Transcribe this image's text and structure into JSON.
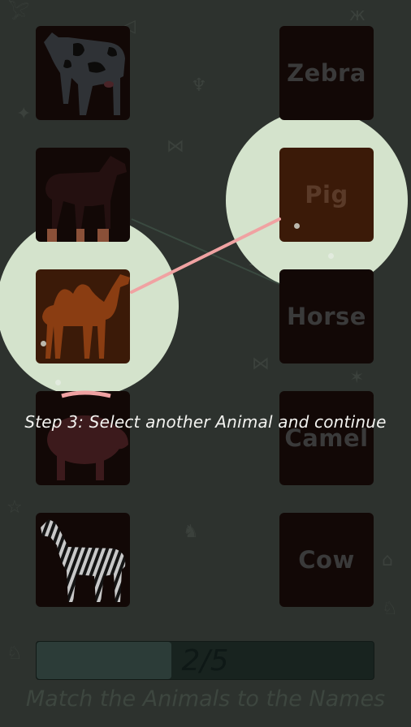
{
  "instruction": "Step 3: Select another Animal and continue",
  "animals": [
    {
      "id": "cow",
      "icon": "cow-icon",
      "highlighted": false
    },
    {
      "id": "horse",
      "icon": "horse-icon",
      "highlighted": false
    },
    {
      "id": "camel",
      "icon": "camel-icon",
      "highlighted": true
    },
    {
      "id": "pig",
      "icon": "pig-icon",
      "highlighted": false
    },
    {
      "id": "zebra",
      "icon": "zebra-icon",
      "highlighted": false
    }
  ],
  "names": [
    {
      "label": "Zebra",
      "highlighted": false
    },
    {
      "label": "Pig",
      "highlighted": true
    },
    {
      "label": "Horse",
      "highlighted": false
    },
    {
      "label": "Camel",
      "highlighted": false
    },
    {
      "label": "Cow",
      "highlighted": false
    }
  ],
  "progress": {
    "current": 2,
    "total": 5,
    "text": "2/5",
    "fraction": 0.4
  },
  "footer_title": "Match the Animals to the Names",
  "colors": {
    "background": "#2d322e",
    "spotlight": "#d4e3cc",
    "connector": "#f0a2a2",
    "card": "#120806",
    "card_active": "#3b1a08"
  }
}
